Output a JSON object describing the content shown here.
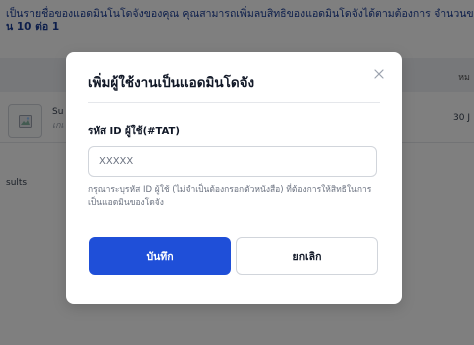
{
  "background": {
    "info_line1": "เป็นรายชื่อของแอดมินโนโดจังของคุณ คุณสามารถเพิ่มลบสิทธิของแอดมินโดจังได้ตามต้องการ จำนวนของแอดมิ",
    "info_line2": "น 10 ต่อ 1",
    "table_header_partial": "หม",
    "row": {
      "name_partial": "Su",
      "sub_partial": "เกเ",
      "date_partial": "30 J"
    },
    "results_partial": "sults"
  },
  "modal": {
    "title": "เพิ่มผู้ใช้งานเป็นแอดมินโดจัง",
    "field_label": "รหัส ID ผู้ใช้(#TAT)",
    "input_placeholder": "XXXXX",
    "hint": "กรุณาระบุรหัส ID ผู้ใช้ (ไม่จำเป็นต้องกรอกตัวหนังสือ) ที่ต้องการให้สิทธิในการเป็นแอดมินของโดจัง",
    "save_label": "บันทึก",
    "cancel_label": "ยกเลิก"
  },
  "colors": {
    "primary": "#1f4fd8",
    "overlay": "rgba(0,0,0,0.5)",
    "info_text": "#1a3d97"
  },
  "icons": {
    "close": "close-icon",
    "image_placeholder": "image-icon"
  }
}
